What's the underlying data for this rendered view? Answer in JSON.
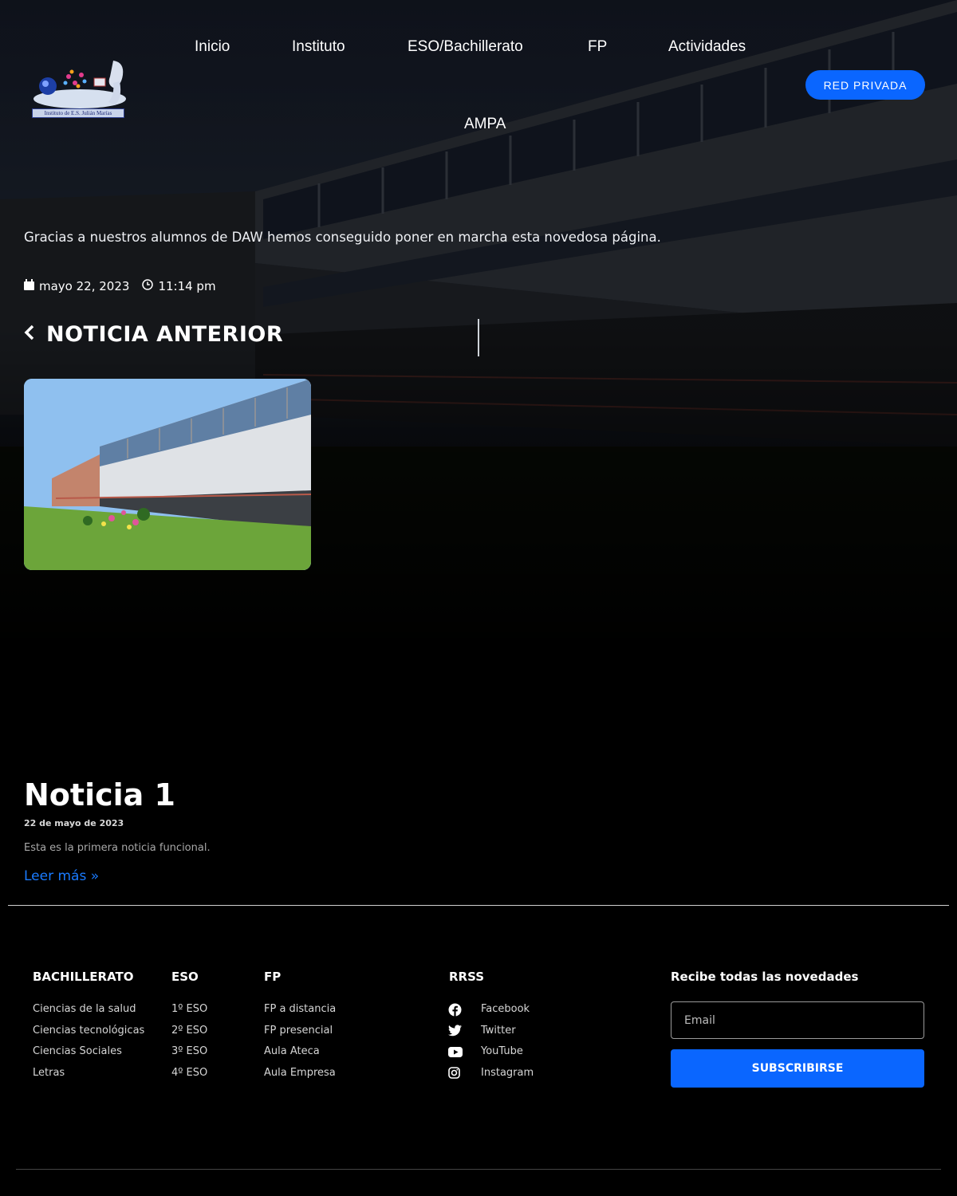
{
  "logo": {
    "caption": "Instituto de E.S. Julián Marías"
  },
  "nav": {
    "items": [
      {
        "label": "Inicio"
      },
      {
        "label": "Instituto"
      },
      {
        "label": "ESO/Bachillerato"
      },
      {
        "label": "FP"
      },
      {
        "label": "Actividades"
      },
      {
        "label": "AMPA"
      }
    ],
    "private_button": "RED PRIVADA"
  },
  "post": {
    "intro": "Gracias a nuestros alumnos de DAW hemos conseguido poner en marcha esta novedosa página.",
    "date": "mayo 22, 2023",
    "time": "11:14 pm",
    "prev_label": "NOTICIA ANTERIOR"
  },
  "news": {
    "title": "Noticia 1",
    "date": "22 de mayo de 2023",
    "excerpt": "Esta es la primera noticia funcional.",
    "read_more": "Leer más »"
  },
  "footer": {
    "columns": [
      {
        "title": "BACHILLERATO",
        "links": [
          "Ciencias de la salud",
          "Ciencias tecnológicas",
          "Ciencias Sociales",
          "Letras"
        ]
      },
      {
        "title": "ESO",
        "links": [
          "1º ESO",
          "2º ESO",
          "3º ESO",
          "4º ESO"
        ]
      },
      {
        "title": "FP",
        "links": [
          "FP a distancia",
          "FP presencial",
          "Aula Ateca",
          "Aula Empresa"
        ]
      },
      {
        "title": "RRSS",
        "links": [
          "Facebook",
          "Twitter",
          "YouTube",
          "Instagram"
        ]
      }
    ],
    "newsletter": {
      "title": "Recibe todas las novedades",
      "email_placeholder": "Email",
      "button": "SUBSCRIBIRSE"
    }
  },
  "colors": {
    "accent": "#0a66ff",
    "link": "#1a7bff",
    "background": "#000000"
  }
}
